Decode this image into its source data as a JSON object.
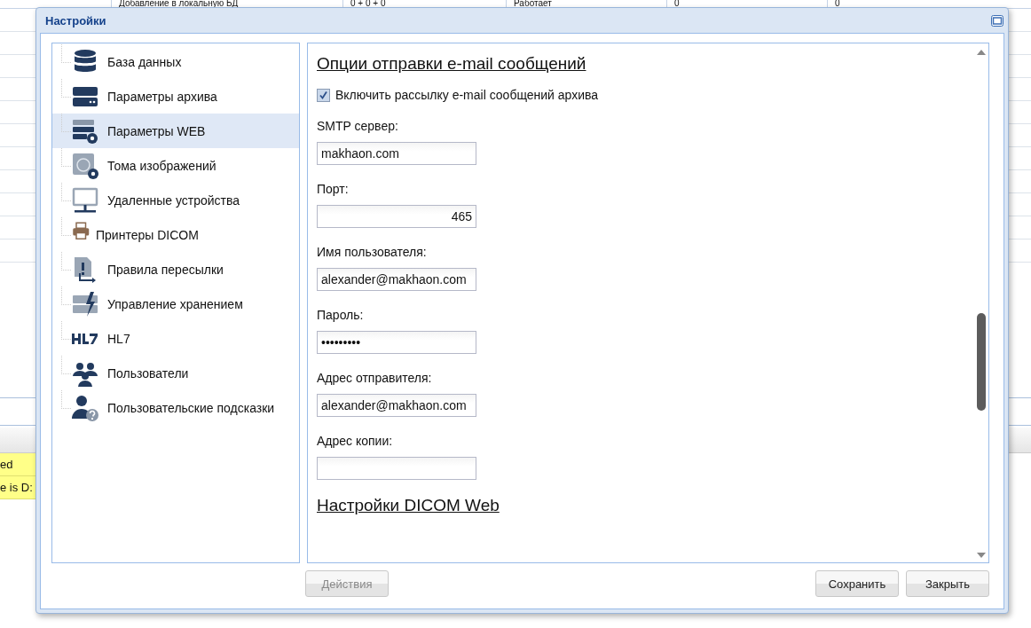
{
  "background": {
    "top_row": [
      "Добавление в локальную БД",
      "0 + 0 + 0",
      "Работает",
      "0",
      "0"
    ],
    "log_rows": [
      "ed",
      "e is D:"
    ]
  },
  "window": {
    "title": "Настройки"
  },
  "sidebar": {
    "items": [
      {
        "label": "База данных",
        "selected": false
      },
      {
        "label": "Параметры архива",
        "selected": false
      },
      {
        "label": "Параметры WEB",
        "selected": true
      },
      {
        "label": "Тома изображений",
        "selected": false
      },
      {
        "label": "Удаленные устройства",
        "selected": false
      },
      {
        "label": "Принтеры DICOM",
        "selected": false
      },
      {
        "label": "Правила пересылки",
        "selected": false
      },
      {
        "label": "Управление хранением",
        "selected": false
      },
      {
        "label": "HL7",
        "selected": false
      },
      {
        "label": "Пользователи",
        "selected": false
      },
      {
        "label": "Пользовательские подсказки",
        "selected": false
      }
    ]
  },
  "form": {
    "heading": "Опции отправки e-mail сообщений",
    "checkbox": {
      "label": "Включить рассылку e-mail сообщений архива",
      "checked": true
    },
    "fields": [
      {
        "label": "SMTP сервер:",
        "value": "makhaon.com",
        "kind": "text"
      },
      {
        "label": "Порт:",
        "value": "465",
        "kind": "number"
      },
      {
        "label": "Имя пользователя:",
        "value": "alexander@makhaon.com",
        "kind": "text"
      },
      {
        "label": "Пароль:",
        "value": "•••••••••",
        "kind": "text"
      },
      {
        "label": "Адрес отправителя:",
        "value": "alexander@makhaon.com",
        "kind": "text"
      },
      {
        "label": "Адрес копии:",
        "kind": "text"
      }
    ],
    "heading_2": "Настройки DICOM Web"
  },
  "buttons": [
    {
      "label": "Действия",
      "disabled": true
    },
    {
      "label": "Сохранить",
      "disabled": false
    },
    {
      "label": "Закрыть",
      "disabled": false
    }
  ]
}
